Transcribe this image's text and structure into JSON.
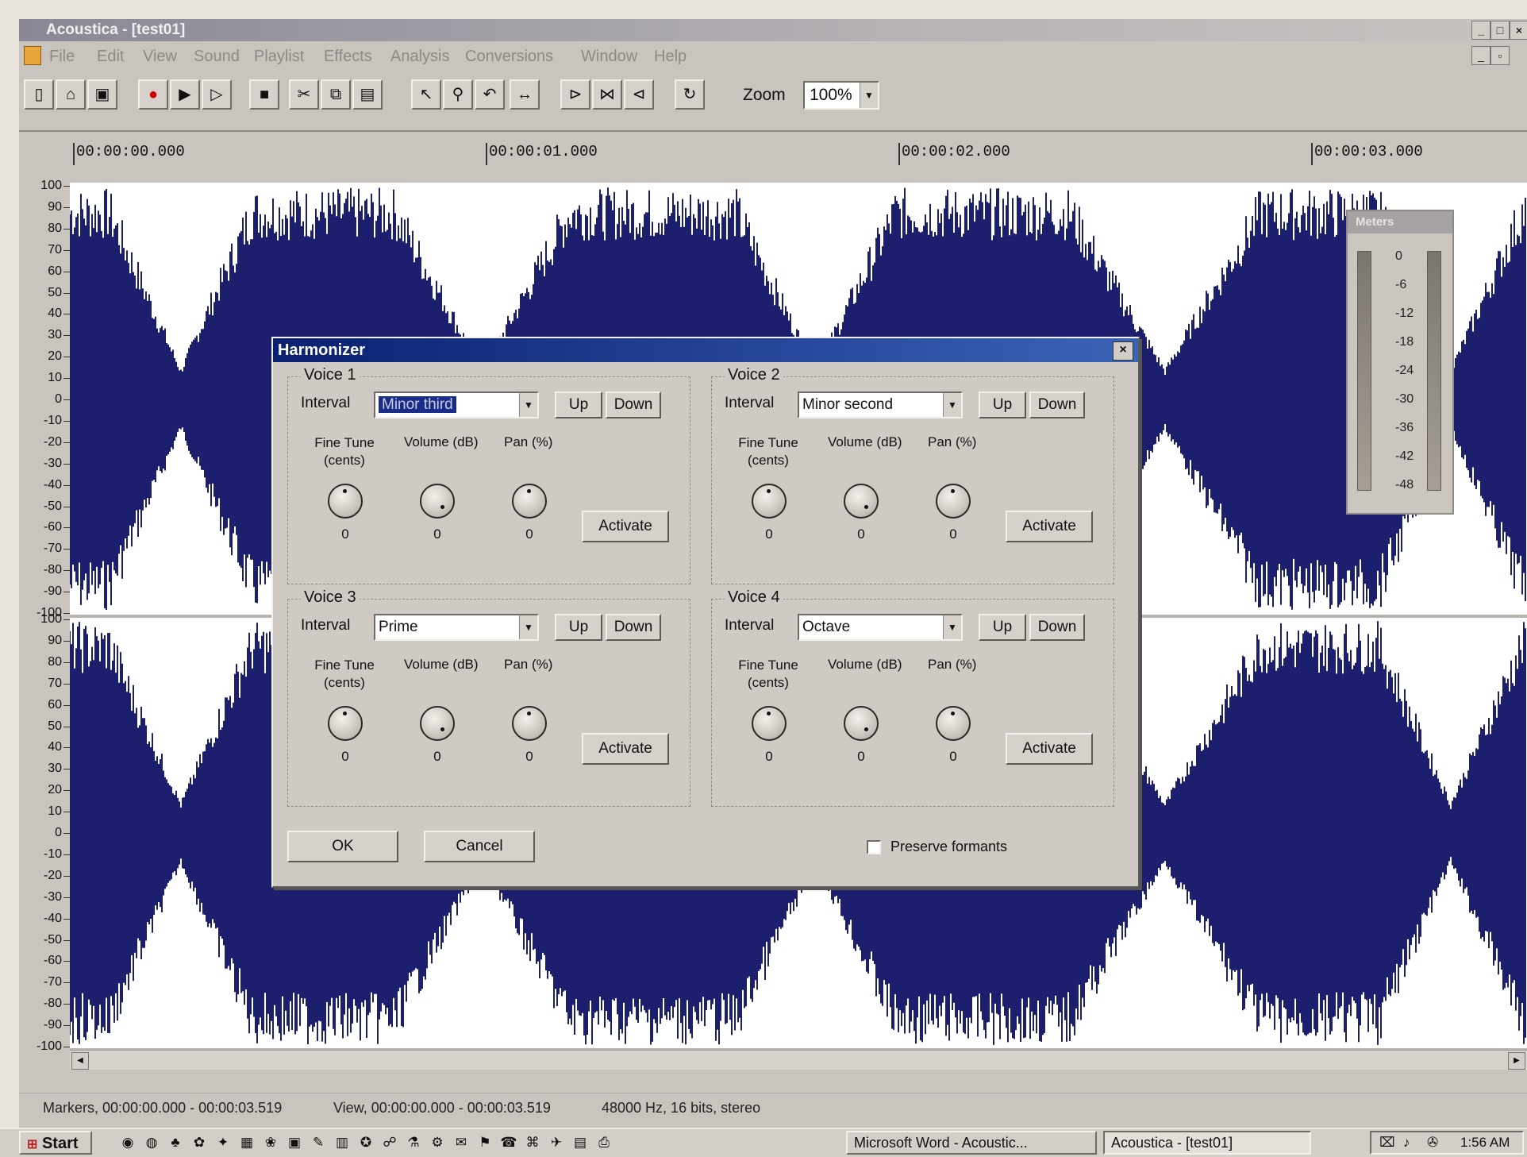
{
  "window": {
    "title": "Acoustica - [test01]",
    "menu": [
      "File",
      "Edit",
      "View",
      "Sound",
      "Playlist",
      "Effects",
      "Analysis",
      "Conversions",
      "Window",
      "Help"
    ],
    "toolbar": {
      "icons": [
        "new-icon",
        "open-icon",
        "save-icon",
        "record-icon",
        "play-icon",
        "play-selection-icon",
        "stop-icon",
        "cut-icon",
        "copy-icon",
        "paste-icon",
        "select-icon",
        "zoom-icon",
        "undo-icon",
        "expand-icon",
        "prev-marker-icon",
        "marker-icon",
        "next-marker-icon",
        "loop-icon"
      ],
      "zoom_label": "Zoom",
      "zoom_value": "100%"
    }
  },
  "timeline": {
    "ticks": [
      "00:00:00.000",
      "00:00:01.000",
      "00:00:02.000",
      "00:00:03.000"
    ]
  },
  "amplitude_axis": {
    "labels": [
      "100",
      "90",
      "80",
      "70",
      "60",
      "50",
      "40",
      "30",
      "20",
      "10",
      "0",
      "-10",
      "-20",
      "-30",
      "-40",
      "-50",
      "-60",
      "-70",
      "-80",
      "-90",
      "-100"
    ]
  },
  "meter": {
    "title": "Meters",
    "scale": [
      "0",
      "-6",
      "-12",
      "-18",
      "-24",
      "-30",
      "-36",
      "-42",
      "-48"
    ]
  },
  "status": {
    "markers": "Markers, 00:00:00.000 - 00:00:03.519",
    "view": "View, 00:00:00.000 - 00:00:03.519",
    "format": "48000 Hz, 16 bits, stereo"
  },
  "harmonizer": {
    "title": "Harmonizer",
    "close": "×",
    "interval_label": "Interval",
    "fine_tune_label": "Fine Tune (cents)",
    "volume_label": "Volume (dB)",
    "pan_label": "Pan (%)",
    "up_label": "Up",
    "down_label": "Down",
    "activate_label": "Activate",
    "voices": [
      {
        "label": "Voice 1",
        "interval": "Minor third",
        "fine_tune": "0",
        "volume": "0",
        "pan": "0"
      },
      {
        "label": "Voice 2",
        "interval": "Minor second",
        "fine_tune": "0",
        "volume": "0",
        "pan": "0"
      },
      {
        "label": "Voice 3",
        "interval": "Prime",
        "fine_tune": "0",
        "volume": "0",
        "pan": "0"
      },
      {
        "label": "Voice 4",
        "interval": "Octave",
        "fine_tune": "0",
        "volume": "0",
        "pan": "0"
      }
    ],
    "ok_label": "OK",
    "cancel_label": "Cancel",
    "preserve_formants_label": "Preserve formants",
    "preserve_formants_checked": false
  },
  "taskbar": {
    "start_label": "Start",
    "tasks": [
      "Microsoft Word - Acoustic...",
      "Acoustica - [test01]"
    ],
    "clock": "1:56 AM"
  },
  "colors": {
    "waveform": "#1c1f6e",
    "dialog_title": "#0a2070",
    "background": "#c9c4bd"
  }
}
